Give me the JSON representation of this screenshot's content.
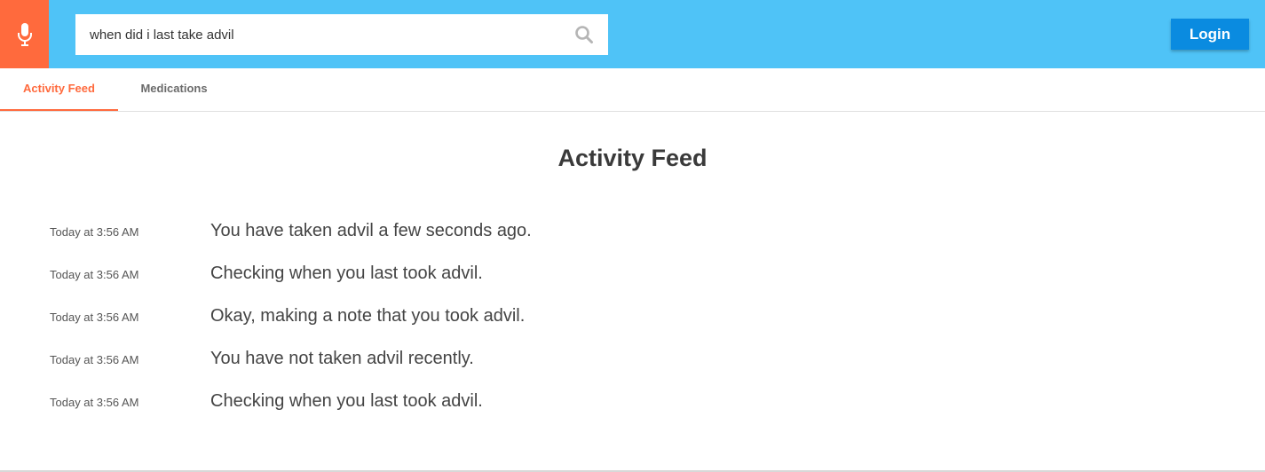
{
  "header": {
    "mic_icon": "microphone-icon",
    "search": {
      "value": "when did i last take advil",
      "placeholder": "",
      "icon": "search-icon"
    },
    "login_label": "Login"
  },
  "tabs": [
    {
      "label": "Activity Feed",
      "active": true
    },
    {
      "label": "Medications",
      "active": false
    }
  ],
  "main": {
    "title": "Activity Feed",
    "feed": [
      {
        "time": "Today at 3:56 AM",
        "message": "You have taken advil a few seconds ago."
      },
      {
        "time": "Today at 3:56 AM",
        "message": "Checking when you last took advil."
      },
      {
        "time": "Today at 3:56 AM",
        "message": "Okay, making a note that you took advil."
      },
      {
        "time": "Today at 3:56 AM",
        "message": "You have not taken advil recently."
      },
      {
        "time": "Today at 3:56 AM",
        "message": "Checking when you last took advil."
      }
    ]
  },
  "colors": {
    "header_bg": "#4fc3f7",
    "mic_bg": "#ff6a3d",
    "accent": "#ff6a3d",
    "login_bg": "#0a8be0"
  }
}
